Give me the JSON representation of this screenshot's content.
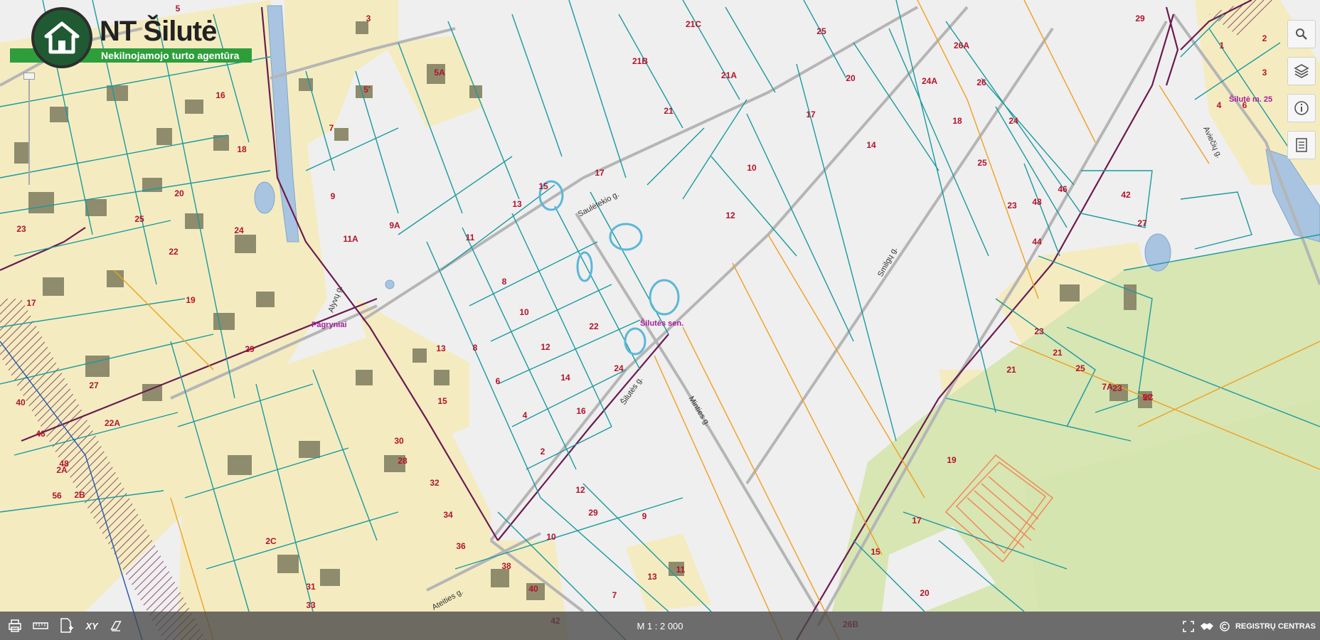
{
  "logo": {
    "title": "NT Šilutė",
    "subtitle": "Nekilnojamojo turto agentūra",
    "icon": "house-icon"
  },
  "map": {
    "place_labels": [
      "Pagryniai",
      "Šilutės sen.",
      "Šilutė m. 25"
    ],
    "street_labels": [
      "Saulėtekio g.",
      "Alyvų g.",
      "Šilutės g.",
      "Minties g.",
      "Smilgų g.",
      "Ateities g.",
      "Aviečių g."
    ],
    "parcel_numbers": [
      "5",
      "3",
      "21C",
      "25",
      "29",
      "26A",
      "5A",
      "5'",
      "21B",
      "21A",
      "20",
      "24A",
      "26",
      "1",
      "2",
      "3",
      "4",
      "6",
      "9",
      "7",
      "16",
      "18",
      "20",
      "23",
      "25",
      "24",
      "22",
      "21",
      "17",
      "15",
      "11A",
      "9A",
      "11",
      "13",
      "17",
      "10",
      "14",
      "18",
      "24",
      "25",
      "48",
      "23",
      "46",
      "44",
      "42",
      "12",
      "27",
      "8",
      "10",
      "12",
      "14",
      "16",
      "22",
      "24",
      "2",
      "4",
      "6",
      "8",
      "13",
      "15",
      "28",
      "30",
      "32",
      "34",
      "36",
      "38",
      "40",
      "42",
      "29",
      "40",
      "46",
      "48",
      "56",
      "2B",
      "2A",
      "2C",
      "31",
      "33",
      "27",
      "22A",
      "17",
      "19",
      "21",
      "25",
      "23",
      "27",
      "12",
      "29",
      "10",
      "7",
      "9",
      "11",
      "13",
      "15",
      "17",
      "19",
      "21",
      "23",
      "7A",
      "5C",
      "20",
      "26B"
    ]
  },
  "toolbar_right": {
    "search": "search-icon",
    "layers": "layers-icon",
    "info": "info-icon",
    "legend": "legend-icon"
  },
  "bottom": {
    "tools": [
      "print-icon",
      "ruler-icon",
      "add-document-icon",
      "xy-coordinates-icon",
      "eraser-icon"
    ],
    "xy_label": "XY",
    "scale": "M 1 : 2 000",
    "provider": "REGISTRŲ CENTRAS"
  }
}
